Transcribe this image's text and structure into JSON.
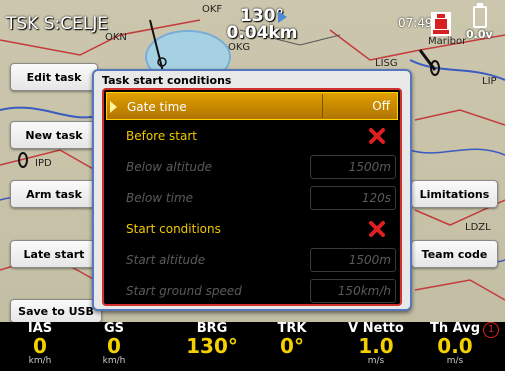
{
  "header": {
    "task_title": "TSK S:CELJE",
    "course_deg": "130°",
    "distance": "0.04km",
    "clock": "07:49",
    "battery_voltage": "0.0v"
  },
  "map_labels": [
    "OKN",
    "OKF",
    "OKG",
    "LISG",
    "Maribor",
    "IPD",
    "LDZL",
    "LIP"
  ],
  "left_buttons": [
    "Edit task",
    "New task",
    "Arm task",
    "Late start",
    "Save to USB"
  ],
  "right_buttons": [
    "Limitations",
    "Team code"
  ],
  "dialog": {
    "title": "Task start conditions",
    "rows": [
      {
        "label": "Gate time",
        "value": "Off",
        "state": "selected"
      },
      {
        "label": "Before start",
        "value": "",
        "state": "active",
        "toggle": "off"
      },
      {
        "label": "Below altitude",
        "value": "1500m",
        "state": "disabled"
      },
      {
        "label": "Below time",
        "value": "120s",
        "state": "disabled"
      },
      {
        "label": "Start conditions",
        "value": "",
        "state": "active",
        "toggle": "off"
      },
      {
        "label": "Start altitude",
        "value": "1500m",
        "state": "disabled"
      },
      {
        "label": "Start ground speed",
        "value": "150km/h",
        "state": "disabled"
      }
    ]
  },
  "infoboxes": [
    {
      "title": "IAS",
      "value": "0",
      "unit": "km/h"
    },
    {
      "title": "GS",
      "value": "0",
      "unit": "km/h"
    },
    {
      "title": "BRG",
      "value": "130°",
      "unit": ""
    },
    {
      "title": "TRK",
      "value": "0°",
      "unit": ""
    },
    {
      "title": "V Netto",
      "value": "1.0",
      "unit": "m/s"
    },
    {
      "title": "Th Avg",
      "value": "0.0",
      "unit": "m/s"
    }
  ],
  "infobar_alert": "1",
  "colors": {
    "accent_yellow": "#f0c800",
    "selection": "#c08400",
    "dialog_border": "#5577bb",
    "inner_border": "#d0312d",
    "toggle_off": "#e02020"
  }
}
